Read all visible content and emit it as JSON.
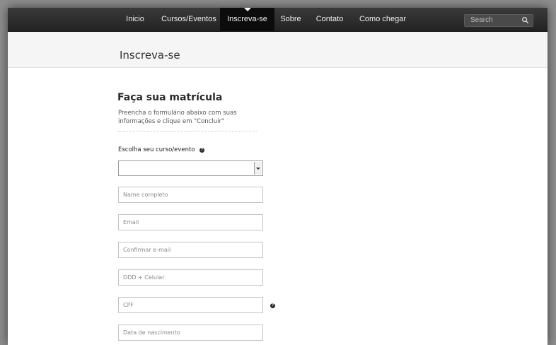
{
  "nav": {
    "items": [
      {
        "label": "Inicio",
        "active": false
      },
      {
        "label": "Cursos/Eventos",
        "active": false
      },
      {
        "label": "Inscreva-se",
        "active": true
      },
      {
        "label": "Sobre",
        "active": false
      },
      {
        "label": "Contato",
        "active": false
      },
      {
        "label": "Como chegar",
        "active": false
      }
    ],
    "search": {
      "placeholder": "Search",
      "icon": "search-icon"
    }
  },
  "header": {
    "title": "Inscreva-se"
  },
  "form": {
    "title": "Faça sua matrícula",
    "subtitle": "Preencha o formulário abaixo com suas informações e clique em \"Concluir\"",
    "course": {
      "label": "Escolha seu curso/evento",
      "help_icon": "help-icon",
      "value": ""
    },
    "fields": [
      {
        "placeholder": "Name completo"
      },
      {
        "placeholder": "Email"
      },
      {
        "placeholder": "Confirmar e-mail"
      },
      {
        "placeholder": "DDD + Celular"
      },
      {
        "placeholder": "CPF",
        "help_icon": "help-icon"
      },
      {
        "placeholder": "Data de nascimento"
      }
    ]
  },
  "colors": {
    "navbar": "#2a2a2a",
    "nav_active": "#0c0c0c",
    "title_bar": "#f5f5f5",
    "field_border": "#c4c4c4",
    "backdrop": "#8e8e8e"
  }
}
